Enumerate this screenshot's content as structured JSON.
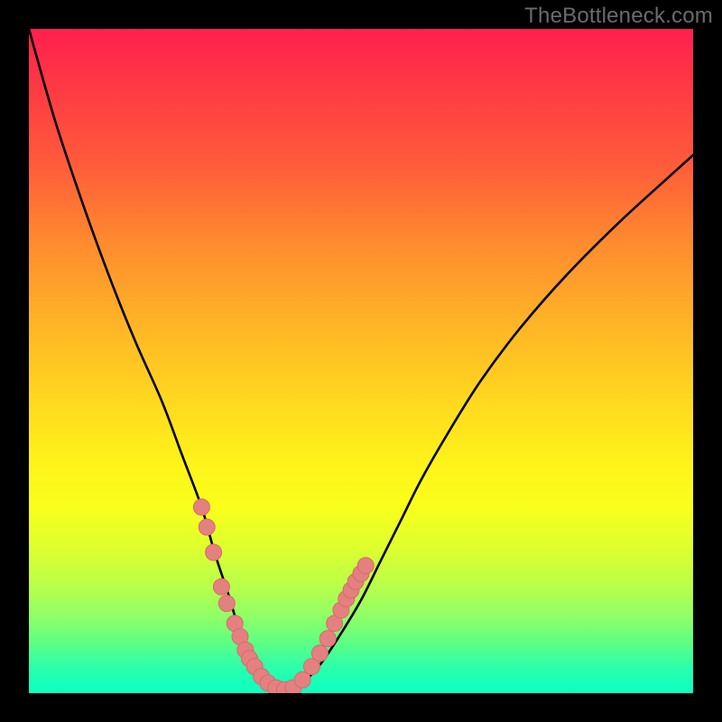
{
  "watermark": "TheBottleneck.com",
  "colors": {
    "frame": "#000000",
    "curve": "#000000",
    "marker_fill": "#e58080",
    "marker_stroke": "#d86a6a",
    "gradient_top": "#ff1f4f",
    "gradient_bottom": "#0dffc4"
  },
  "chart_data": {
    "type": "line",
    "title": "",
    "xlabel": "",
    "ylabel": "",
    "xlim": [
      0,
      1
    ],
    "ylim": [
      0,
      1
    ],
    "notes": "V-shaped bottleneck curve over a red→yellow→green vertical gradient. Coordinates are normalized to the inner plot area (0..1 in each axis, y=0 at top).",
    "series": [
      {
        "name": "bottleneck-curve",
        "x": [
          0.0,
          0.04,
          0.08,
          0.12,
          0.16,
          0.2,
          0.23,
          0.26,
          0.28,
          0.3,
          0.315,
          0.33,
          0.345,
          0.36,
          0.375,
          0.395,
          0.415,
          0.44,
          0.47,
          0.5,
          0.53,
          0.56,
          0.59,
          0.63,
          0.68,
          0.74,
          0.81,
          0.89,
          0.96,
          1.0
        ],
        "y": [
          0.0,
          0.14,
          0.26,
          0.37,
          0.47,
          0.56,
          0.64,
          0.72,
          0.79,
          0.85,
          0.9,
          0.94,
          0.965,
          0.982,
          0.994,
          0.995,
          0.982,
          0.955,
          0.91,
          0.86,
          0.8,
          0.74,
          0.68,
          0.61,
          0.53,
          0.45,
          0.37,
          0.29,
          0.226,
          0.19
        ]
      },
      {
        "name": "marker-cluster",
        "x": [
          0.26,
          0.268,
          0.278,
          0.29,
          0.298,
          0.31,
          0.318,
          0.326,
          0.332,
          0.34,
          0.35,
          0.36,
          0.372,
          0.385,
          0.398,
          0.412,
          0.426,
          0.438,
          0.45,
          0.46,
          0.47,
          0.478,
          0.485,
          0.492,
          0.5,
          0.507
        ],
        "y": [
          0.72,
          0.75,
          0.788,
          0.84,
          0.865,
          0.895,
          0.915,
          0.935,
          0.948,
          0.96,
          0.975,
          0.985,
          0.992,
          0.995,
          0.992,
          0.98,
          0.96,
          0.94,
          0.918,
          0.895,
          0.875,
          0.858,
          0.845,
          0.832,
          0.82,
          0.808
        ]
      }
    ]
  }
}
